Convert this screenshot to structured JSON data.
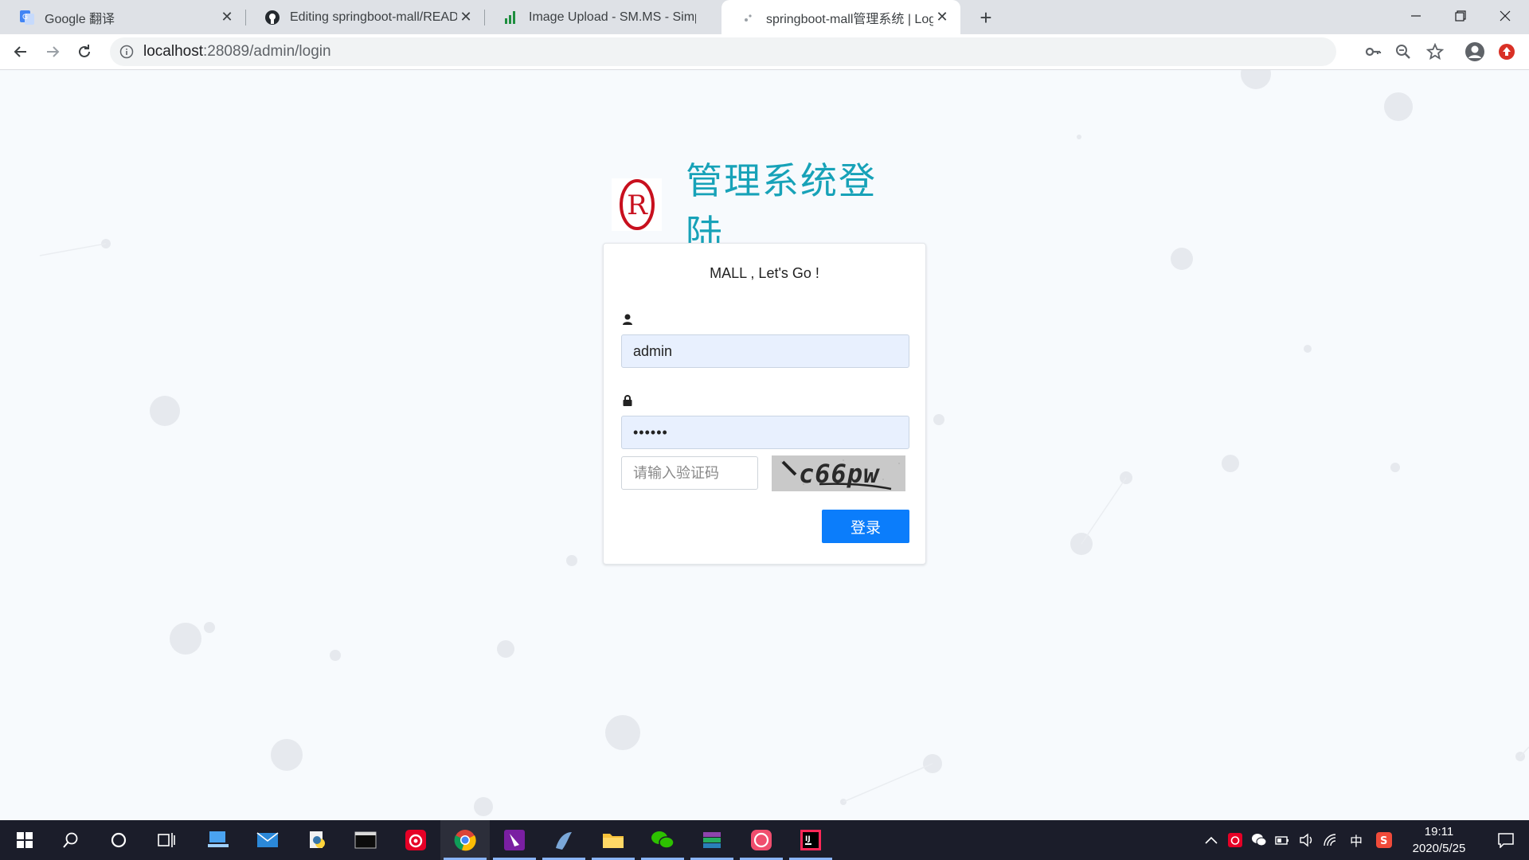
{
  "browser": {
    "tabs": [
      {
        "title": "Google 翻译",
        "icon": "google-translate-icon"
      },
      {
        "title": "Editing springboot-mall/READ",
        "icon": "github-icon"
      },
      {
        "title": "Image Upload - SM.MS - Simp",
        "icon": "bar-chart-icon"
      },
      {
        "title": "springboot-mall管理系统 | Log",
        "icon": "loading-icon",
        "active": true
      }
    ],
    "url_host": "localhost",
    "url_rest": ":28089/admin/login"
  },
  "page": {
    "title": "管理系统登陆",
    "message": "MALL , Let's Go !",
    "username_value": "admin",
    "password_value": "••••••",
    "captcha_placeholder": "请输入验证码",
    "captcha_text": "c66pw",
    "login_label": "登录",
    "accent_color": "#17a2b8",
    "button_color": "#0b7dfb"
  },
  "taskbar": {
    "time": "19:11",
    "date": "2020/5/25",
    "ime": "中"
  }
}
